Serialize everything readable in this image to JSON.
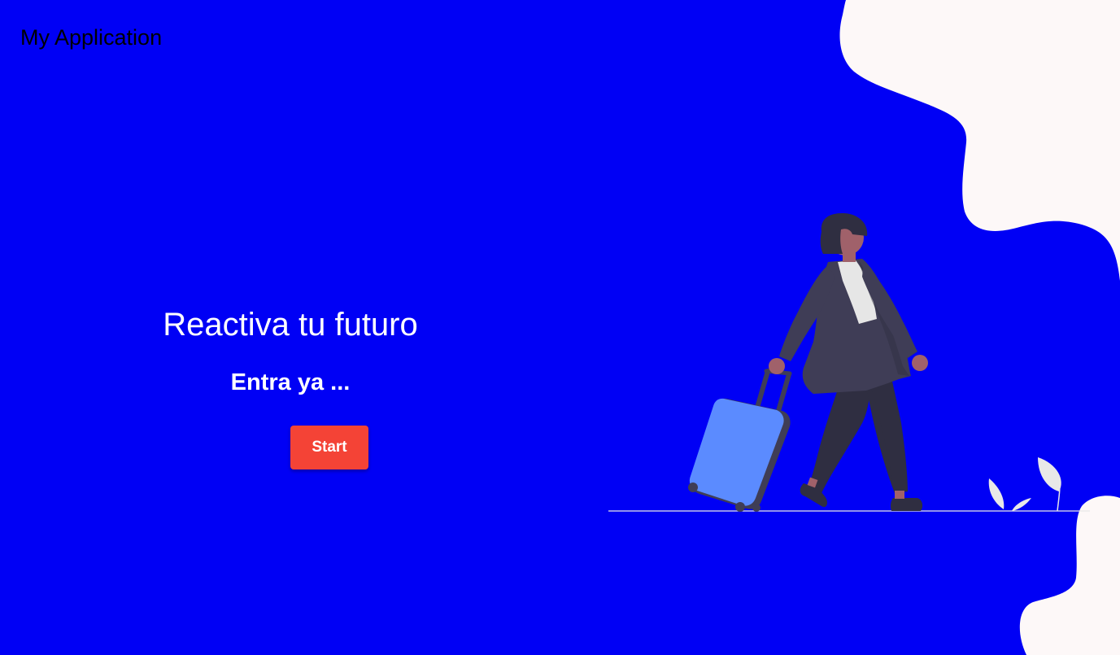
{
  "app": {
    "title": "My Application"
  },
  "hero": {
    "title": "Reactiva tu futuro",
    "subtitle": "Entra ya ...",
    "start_label": "Start"
  },
  "colors": {
    "background": "#0000f5",
    "blob": "#fdf8f8",
    "button": "#f44336",
    "suitcase": "#5b8bff"
  },
  "illustration": {
    "subject": "woman-pulling-suitcase"
  }
}
